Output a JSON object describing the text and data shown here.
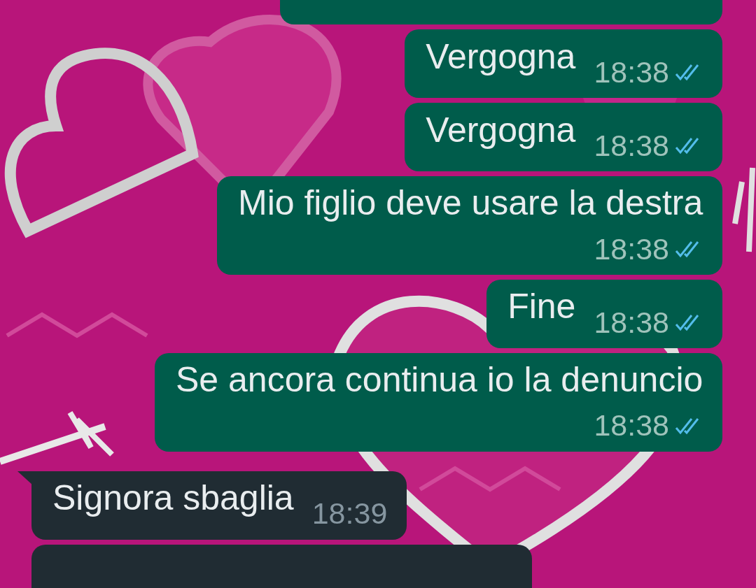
{
  "messages": [
    {
      "kind": "outgoing"
    },
    {
      "kind": "outgoing",
      "text": "Vergogna",
      "time": "18:38",
      "read": true
    },
    {
      "kind": "outgoing",
      "text": "Vergogna",
      "time": "18:38",
      "read": true
    },
    {
      "kind": "outgoing",
      "text": "Mio figlio deve usare la destra",
      "time": "18:38",
      "read": true
    },
    {
      "kind": "outgoing",
      "text": "Fine",
      "time": "18:38",
      "read": true
    },
    {
      "kind": "outgoing",
      "text": "Se ancora continua io la denuncio",
      "time": "18:38",
      "read": true
    },
    {
      "kind": "incoming",
      "text": "Signora sbaglia",
      "time": "18:39",
      "tail": true
    },
    {
      "kind": "incoming"
    }
  ]
}
